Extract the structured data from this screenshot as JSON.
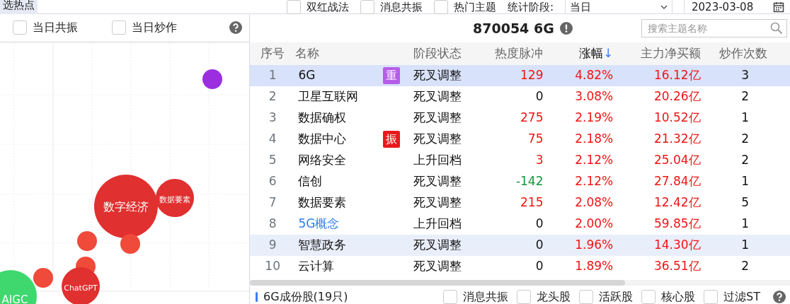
{
  "top_bar": {
    "tab": {
      "label": "选热点",
      "selected": true
    },
    "filters": [
      {
        "label": "双红战法",
        "checked": false
      },
      {
        "label": "消息共振",
        "checked": false
      },
      {
        "label": "热门主题",
        "checked": false
      }
    ],
    "period_label": "统计阶段:",
    "period_value": "当日",
    "date": "2023-03-08"
  },
  "left_panel": {
    "filters": [
      {
        "label": "当日共振",
        "checked": false
      },
      {
        "label": "当日炒作",
        "checked": false
      }
    ],
    "bubbles": [
      {
        "color": "#9b2fe0"
      },
      {
        "label": "数字经济",
        "color": "#e0302f"
      },
      {
        "label": "数据要素",
        "color": "#e0302f"
      },
      {
        "color": "#f04a3a"
      },
      {
        "color": "#f04a3a"
      },
      {
        "color": "#f04a3a"
      },
      {
        "color": "#f04a3a"
      },
      {
        "label": "ChatGPT",
        "color": "#e0302f"
      },
      {
        "label": "AIGC",
        "color": "#3ed86e"
      }
    ]
  },
  "right_panel": {
    "title": "870054 6G",
    "search": {
      "placeholder": "搜索主题名称"
    },
    "columns": [
      {
        "label": "序号"
      },
      {
        "label": "名称"
      },
      {
        "label": "阶段状态"
      },
      {
        "label": "热度脉冲"
      },
      {
        "label": "涨幅",
        "sort_mark": "↓"
      },
      {
        "label": "主力净买额"
      },
      {
        "label": "炒作次数"
      }
    ],
    "rows": [
      {
        "no": "1",
        "name": "6G",
        "link": false,
        "badge": {
          "text": "重",
          "color": "#b55ce8"
        },
        "stage": "死叉调整",
        "heat": {
          "text": "129",
          "color": "#f01414"
        },
        "change": "4.82%",
        "net_buy": "16.12亿",
        "count": "3",
        "selected": true,
        "highlighted": false
      },
      {
        "no": "2",
        "name": "卫星互联网",
        "link": false,
        "stage": "死叉调整",
        "heat": {
          "text": "0",
          "color": "#111111"
        },
        "change": "3.08%",
        "net_buy": "20.26亿",
        "count": "2",
        "selected": false,
        "highlighted": false
      },
      {
        "no": "3",
        "name": "数据确权",
        "link": false,
        "stage": "死叉调整",
        "heat": {
          "text": "275",
          "color": "#f01414"
        },
        "change": "2.19%",
        "net_buy": "10.52亿",
        "count": "1",
        "selected": false,
        "highlighted": false
      },
      {
        "no": "4",
        "name": "数据中心",
        "link": false,
        "badge": {
          "text": "振",
          "color": "#e8191c"
        },
        "stage": "死叉调整",
        "heat": {
          "text": "75",
          "color": "#f01414"
        },
        "change": "2.18%",
        "net_buy": "21.32亿",
        "count": "2",
        "selected": false,
        "highlighted": false
      },
      {
        "no": "5",
        "name": "网络安全",
        "link": false,
        "stage": "上升回档",
        "heat": {
          "text": "3",
          "color": "#f01414"
        },
        "change": "2.12%",
        "net_buy": "25.04亿",
        "count": "2",
        "selected": false,
        "highlighted": false
      },
      {
        "no": "6",
        "name": "信创",
        "link": false,
        "stage": "死叉调整",
        "heat": {
          "text": "-142",
          "color": "#15953c"
        },
        "change": "2.12%",
        "net_buy": "27.84亿",
        "count": "1",
        "selected": false,
        "highlighted": false
      },
      {
        "no": "7",
        "name": "数据要素",
        "link": false,
        "stage": "死叉调整",
        "heat": {
          "text": "215",
          "color": "#f01414"
        },
        "change": "2.08%",
        "net_buy": "12.42亿",
        "count": "5",
        "selected": false,
        "highlighted": false
      },
      {
        "no": "8",
        "name": "5G概念",
        "link": true,
        "stage": "上升回档",
        "heat": {
          "text": "0",
          "color": "#111111"
        },
        "change": "2.00%",
        "net_buy": "59.85亿",
        "count": "1",
        "selected": false,
        "highlighted": false
      },
      {
        "no": "9",
        "name": "智慧政务",
        "link": false,
        "stage": "死叉调整",
        "heat": {
          "text": "0",
          "color": "#111111"
        },
        "change": "1.96%",
        "net_buy": "14.30亿",
        "count": "1",
        "selected": false,
        "highlighted": true
      },
      {
        "no": "10",
        "name": "云计算",
        "link": false,
        "stage": "死叉调整",
        "heat": {
          "text": "0",
          "color": "#111111"
        },
        "change": "1.89%",
        "net_buy": "36.51亿",
        "count": "2",
        "selected": false,
        "highlighted": false
      }
    ],
    "footer": {
      "label": "6G成份股(19只)",
      "filters": [
        {
          "label": "消息共振",
          "checked": false
        },
        {
          "label": "龙头股",
          "checked": false
        },
        {
          "label": "活跃股",
          "checked": false
        },
        {
          "label": "核心股",
          "checked": false
        },
        {
          "label": "过滤ST",
          "checked": false
        }
      ]
    }
  }
}
